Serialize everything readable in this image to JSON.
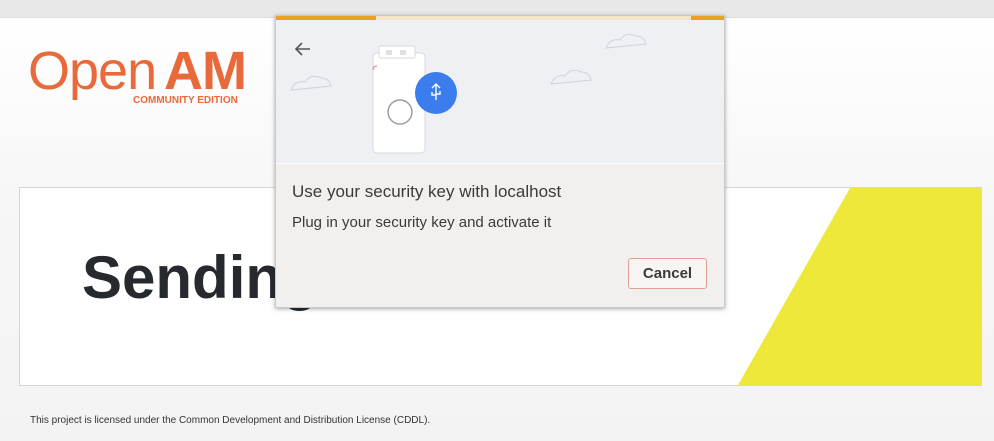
{
  "logo": {
    "word_open": "Open",
    "word_am": "AM",
    "edition": "COMMUNITY EDITION"
  },
  "card": {
    "heading": "Sending"
  },
  "footer": {
    "license_text": "This project is licensed under the Common Development and Distribution License (CDDL)."
  },
  "dialog": {
    "title": "Use your security key with localhost",
    "message": "Plug in your security key and activate it",
    "cancel_label": "Cancel",
    "back_icon": "arrow-left-icon",
    "illustration_icon": "usb-icon"
  },
  "colors": {
    "brand": "#e86a3a",
    "accent_yellow": "#ede83a",
    "usb_blue": "#3b7ded",
    "progress": "#e8a21f"
  }
}
